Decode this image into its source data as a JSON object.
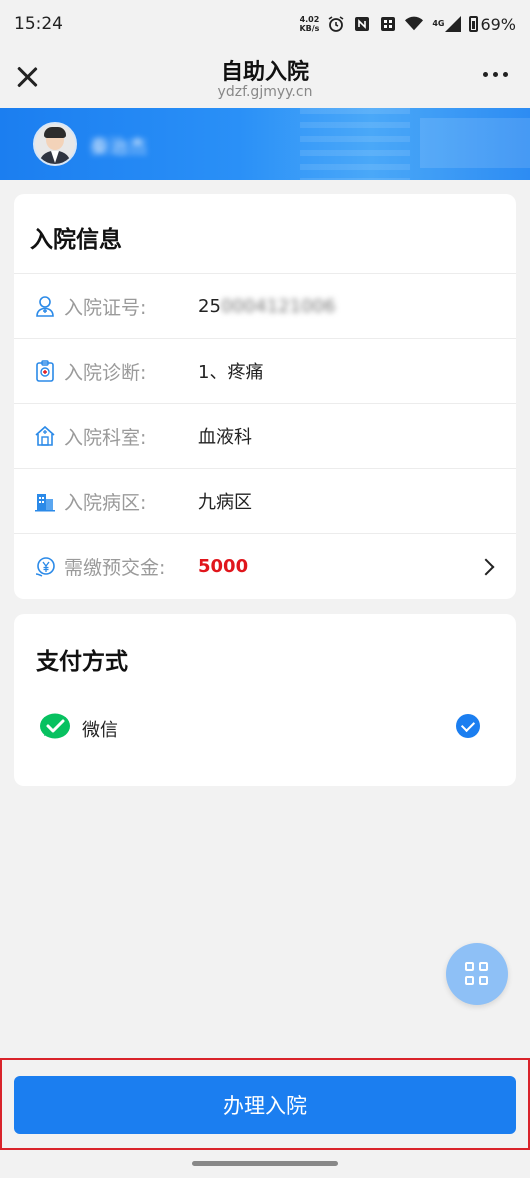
{
  "status_bar": {
    "time": "15:24",
    "net_speed_value": "4.02",
    "net_speed_unit": "KB/s",
    "signal_label": "4G",
    "battery": "69%"
  },
  "title_bar": {
    "title": "自助入院",
    "url": "ydzf.gjmyy.cn"
  },
  "banner": {
    "user_name": "秦治杰"
  },
  "info_card": {
    "title": "入院信息",
    "rows": [
      {
        "label": "入院证号:",
        "value": "25",
        "value_masked": "0004121006",
        "icon": "doctor-icon"
      },
      {
        "label": "入院诊断:",
        "value": "1、疼痛",
        "icon": "medical-record-icon"
      },
      {
        "label": "入院科室:",
        "value": "血液科",
        "icon": "hospital-icon"
      },
      {
        "label": "入院病区:",
        "value": "九病区",
        "icon": "building-icon"
      },
      {
        "label": "需缴预交金:",
        "value": "5000",
        "icon": "yuan-icon"
      }
    ]
  },
  "payment_card": {
    "title": "支付方式",
    "method": "微信",
    "selected": true
  },
  "actions": {
    "submit_label": "办理入院"
  },
  "colors": {
    "primary": "#1b7ef0",
    "amount_red": "#e0161c",
    "wechat_green": "#07c160"
  }
}
